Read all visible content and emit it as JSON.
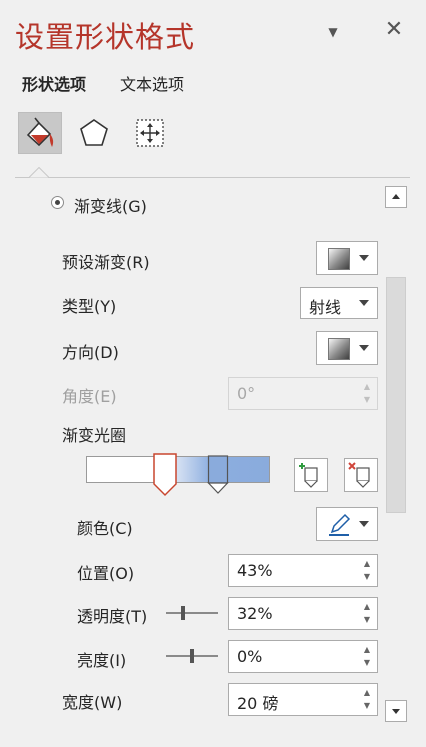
{
  "panel": {
    "title": "设置形状格式"
  },
  "tabs": [
    {
      "label": "形状选项",
      "active": true
    },
    {
      "label": "文本选项",
      "active": false
    }
  ],
  "icon_tabs": [
    {
      "name": "fill-line-icon",
      "selected": true
    },
    {
      "name": "effects-pentagon-icon",
      "selected": false
    },
    {
      "name": "size-properties-icon",
      "selected": false
    }
  ],
  "gradient": {
    "radio_label": "渐变线(G)",
    "preset_label": "预设渐变(R)",
    "type_label": "类型(Y)",
    "type_value": "射线",
    "direction_label": "方向(D)",
    "angle_label": "角度(E)",
    "angle_value": "0°",
    "stops_label": "渐变光圈",
    "stops": [
      {
        "position_pct": 43,
        "color": "#ffffff",
        "selected": true
      },
      {
        "position_pct": 72,
        "color": "#8aabdc",
        "selected": false
      }
    ],
    "color_label": "颜色(C)",
    "position_label": "位置(O)",
    "position_value": "43%",
    "transparency_label": "透明度(T)",
    "transparency_value": "32%",
    "transparency_fraction": 0.32,
    "brightness_label": "亮度(I)",
    "brightness_value": "0%",
    "brightness_fraction": 0.5,
    "width_label": "宽度(W)",
    "width_value": "20 磅"
  },
  "colors": {
    "accent": "#b5352a",
    "gradient_blue": "#8aabdc",
    "add_stop_green": "#2e9b3f",
    "remove_stop_red": "#d0453a"
  }
}
